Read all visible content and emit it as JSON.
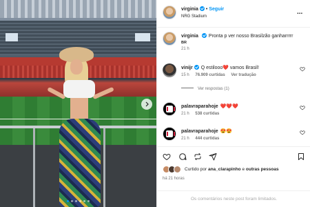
{
  "post": {
    "author": "virginia",
    "follow_label": "Seguir",
    "separator": "•",
    "location": "NRG Stadium",
    "more_label": "...",
    "caption_text": "Pronta p ver nosso Brasilzão ganharrrrr",
    "caption_sub": "BR",
    "caption_time": "21 h",
    "carousel": {
      "total": 6,
      "active": 1
    }
  },
  "comments": [
    {
      "user": "vinijr",
      "verified": true,
      "text": "Q estilooo❤️ vamos Brasil!",
      "time": "15 h",
      "likes": "76.909 curtidas",
      "translate": "Ver tradução",
      "replies": "Ver respostas (1)"
    },
    {
      "user": "palavraparahoje",
      "verified": false,
      "text": "❤️❤️❤️",
      "time": "21 h",
      "likes": "538 curtidas"
    },
    {
      "user": "palavraparahoje",
      "verified": false,
      "text": "😍😍",
      "time": "21 h",
      "likes": "444 curtidas"
    }
  ],
  "likes": {
    "prefix": "Curtido por",
    "user": "ana_clarapinho",
    "suffix": "e",
    "others": "outras pessoas"
  },
  "time_ago": "há 21 horas",
  "footer": "Os comentários neste post foram limitados.",
  "colors": {
    "accent": "#0095f6",
    "heart": "#ed4956",
    "muted": "#737373"
  },
  "icons": {
    "like": "heart-icon",
    "comment": "comment-icon",
    "share": "share-icon",
    "repost": "repost-icon",
    "save": "bookmark-icon",
    "next": "chevron-right-icon"
  }
}
